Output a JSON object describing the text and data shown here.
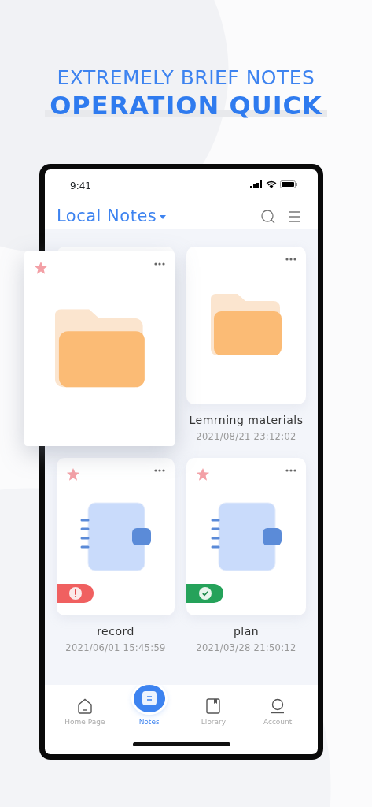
{
  "headline": {
    "line_1": "EXTREMELY BRIEF NOTES",
    "line_2": "OPERATION QUICK"
  },
  "status_bar": {
    "time": "9:41"
  },
  "header": {
    "title": "Local Notes"
  },
  "notes": [
    {
      "kind": "folder",
      "starred": true,
      "lifted": true
    },
    {
      "kind": "folder",
      "starred": false,
      "lifted": false,
      "name": "Lemrning materials",
      "date": "2021/08/21 23:12:02"
    },
    {
      "kind": "notebook",
      "starred": true,
      "lifted": false,
      "alert": true,
      "name": "record",
      "date": "2021/06/01 15:45:59"
    },
    {
      "kind": "notebook",
      "starred": true,
      "lifted": false,
      "alert": false,
      "name": "plan",
      "date": "2021/03/28 21:50:12"
    }
  ],
  "tab_bar": [
    {
      "kind": "home",
      "label": "Home Page",
      "selected": false
    },
    {
      "kind": "notes",
      "label": "Notes",
      "selected": true
    },
    {
      "kind": "library",
      "label": "Library",
      "selected": false
    },
    {
      "kind": "account",
      "label": "Account",
      "selected": false
    }
  ]
}
